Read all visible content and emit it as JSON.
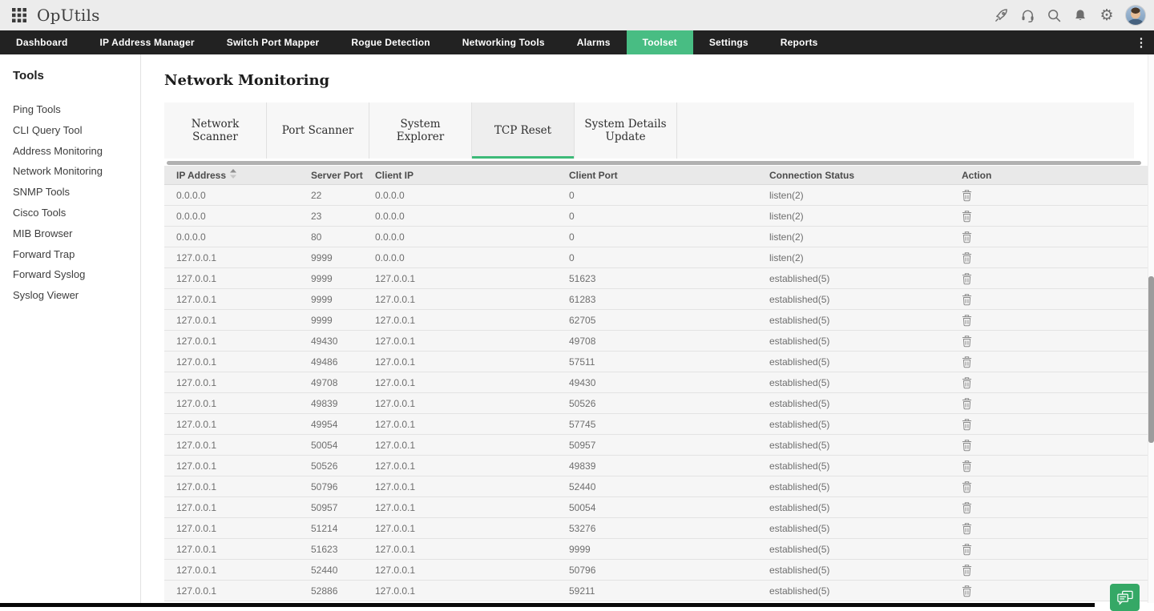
{
  "colors": {
    "accent_green": "#48bd83",
    "tab_underline_green": "#3dba78",
    "chat_button_green": "#35a866",
    "nav_bg": "#222222",
    "topbar_bg": "#ececec",
    "table_header_bg": "#e9e9e9",
    "table_row_bg": "#f6f6f6"
  },
  "topbar": {
    "app_name": "OpUtils",
    "left_icon": "apps-grid-icon",
    "right_icons": [
      "rocket-icon",
      "headset-icon",
      "search-icon",
      "bell-icon",
      "gear-icon"
    ],
    "avatar": "user-avatar"
  },
  "nav": {
    "items": [
      {
        "label": "Dashboard",
        "active": false
      },
      {
        "label": "IP Address Manager",
        "active": false
      },
      {
        "label": "Switch Port Mapper",
        "active": false
      },
      {
        "label": "Rogue Detection",
        "active": false
      },
      {
        "label": "Networking Tools",
        "active": false
      },
      {
        "label": "Alarms",
        "active": false
      },
      {
        "label": "Toolset",
        "active": true
      },
      {
        "label": "Settings",
        "active": false
      },
      {
        "label": "Reports",
        "active": false
      }
    ],
    "overflow_icon": "kebab-menu-icon",
    "overflow_glyph": "⋮"
  },
  "sidebar": {
    "title": "Tools",
    "items": [
      "Ping Tools",
      "CLI Query Tool",
      "Address Monitoring",
      "Network Monitoring",
      "SNMP Tools",
      "Cisco Tools",
      "MIB Browser",
      "Forward Trap",
      "Forward Syslog",
      "Syslog Viewer"
    ]
  },
  "main": {
    "title": "Network Monitoring",
    "tabs": [
      {
        "label": "Network Scanner",
        "active": false
      },
      {
        "label": "Port Scanner",
        "active": false
      },
      {
        "label": "System Explorer",
        "active": false
      },
      {
        "label": "TCP Reset",
        "active": true
      },
      {
        "label": "System Details Update",
        "active": false
      }
    ],
    "table": {
      "columns": [
        {
          "label": "IP Address",
          "sorted": true,
          "sort_icon": "sort-asc-icon"
        },
        {
          "label": "Server Port",
          "sorted": false
        },
        {
          "label": "Client IP",
          "sorted": false
        },
        {
          "label": "Client Port",
          "sorted": false
        },
        {
          "label": "Connection Status",
          "sorted": false
        },
        {
          "label": "Action",
          "sorted": false
        }
      ],
      "action_icon": "trash-icon",
      "rows": [
        [
          "0.0.0.0",
          "22",
          "0.0.0.0",
          "0",
          "listen(2)"
        ],
        [
          "0.0.0.0",
          "23",
          "0.0.0.0",
          "0",
          "listen(2)"
        ],
        [
          "0.0.0.0",
          "80",
          "0.0.0.0",
          "0",
          "listen(2)"
        ],
        [
          "127.0.0.1",
          "9999",
          "0.0.0.0",
          "0",
          "listen(2)"
        ],
        [
          "127.0.0.1",
          "9999",
          "127.0.0.1",
          "51623",
          "established(5)"
        ],
        [
          "127.0.0.1",
          "9999",
          "127.0.0.1",
          "61283",
          "established(5)"
        ],
        [
          "127.0.0.1",
          "9999",
          "127.0.0.1",
          "62705",
          "established(5)"
        ],
        [
          "127.0.0.1",
          "49430",
          "127.0.0.1",
          "49708",
          "established(5)"
        ],
        [
          "127.0.0.1",
          "49486",
          "127.0.0.1",
          "57511",
          "established(5)"
        ],
        [
          "127.0.0.1",
          "49708",
          "127.0.0.1",
          "49430",
          "established(5)"
        ],
        [
          "127.0.0.1",
          "49839",
          "127.0.0.1",
          "50526",
          "established(5)"
        ],
        [
          "127.0.0.1",
          "49954",
          "127.0.0.1",
          "57745",
          "established(5)"
        ],
        [
          "127.0.0.1",
          "50054",
          "127.0.0.1",
          "50957",
          "established(5)"
        ],
        [
          "127.0.0.1",
          "50526",
          "127.0.0.1",
          "49839",
          "established(5)"
        ],
        [
          "127.0.0.1",
          "50796",
          "127.0.0.1",
          "52440",
          "established(5)"
        ],
        [
          "127.0.0.1",
          "50957",
          "127.0.0.1",
          "50054",
          "established(5)"
        ],
        [
          "127.0.0.1",
          "51214",
          "127.0.0.1",
          "53276",
          "established(5)"
        ],
        [
          "127.0.0.1",
          "51623",
          "127.0.0.1",
          "9999",
          "established(5)"
        ],
        [
          "127.0.0.1",
          "52440",
          "127.0.0.1",
          "50796",
          "established(5)"
        ],
        [
          "127.0.0.1",
          "52886",
          "127.0.0.1",
          "59211",
          "established(5)"
        ]
      ]
    }
  },
  "chat_button": {
    "icon": "chat-bubbles-icon"
  }
}
